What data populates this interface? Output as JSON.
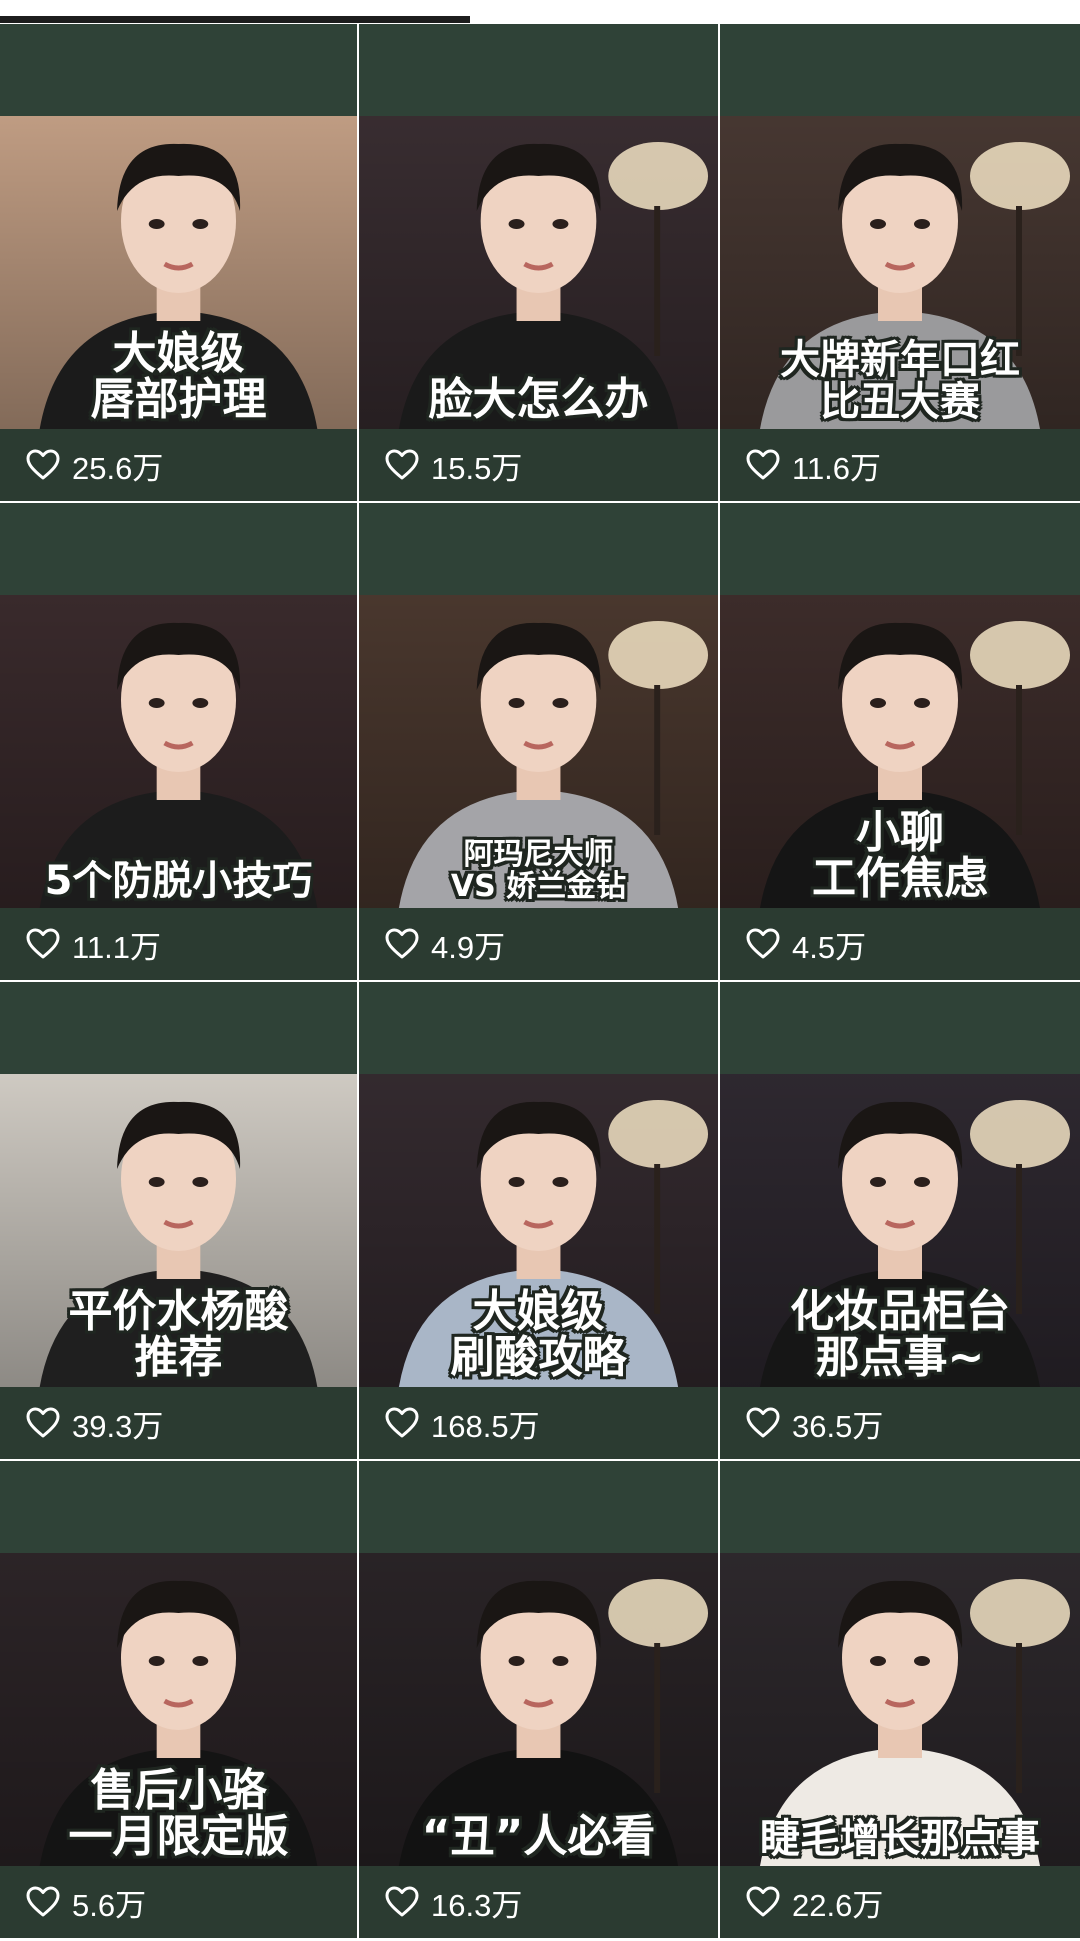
{
  "progress": {
    "fraction": 0.5
  },
  "videos": [
    {
      "caption_l1": "大娘级",
      "caption_l2": "唇部护理",
      "likes": "25.6万",
      "bg": "#c9a489",
      "shirt": "#1b1b1b"
    },
    {
      "caption_l1": "",
      "caption_l2": "脸大怎么办",
      "likes": "15.5万",
      "bg": "#3b2f33",
      "shirt": "#1a1a1a"
    },
    {
      "caption_l1": "大牌新年口红",
      "caption_l2": "比丑大赛",
      "likes": "11.6万",
      "bg": "#4a3a34",
      "shirt": "#9a9a9c"
    },
    {
      "caption_l1": "",
      "caption_l2": "5个防脱小技巧",
      "likes": "11.1万",
      "bg": "#3c2c2e",
      "shirt": "#1c1c1c"
    },
    {
      "caption_l1": "阿玛尼大师",
      "caption_l2": "VS 娇兰金钻",
      "likes": "4.9万",
      "bg": "#4d3a30",
      "shirt": "#a4a4a8"
    },
    {
      "caption_l1": "小聊",
      "caption_l2": "工作焦虑",
      "likes": "4.5万",
      "bg": "#3f2e2c",
      "shirt": "#151515"
    },
    {
      "caption_l1": "平价水杨酸",
      "caption_l2": "推荐",
      "likes": "39.3万",
      "bg": "#d9d4cc",
      "shirt": "#1f1f1f"
    },
    {
      "caption_l1": "大娘级",
      "caption_l2": "刷酸攻略",
      "likes": "168.5万",
      "bg": "#362c31",
      "shirt": "#a9b6c7"
    },
    {
      "caption_l1": "化妆品柜台",
      "caption_l2": "那点事~",
      "likes": "36.5万",
      "bg": "#302a32",
      "shirt": "#161616"
    },
    {
      "caption_l1": "售后小骆",
      "caption_l2": "一月限定版",
      "likes": "5.6万",
      "bg": "#2e2629",
      "shirt": "#141414"
    },
    {
      "caption_l1": "",
      "caption_l2": "“丑”人必看",
      "likes": "16.3万",
      "bg": "#2b2528",
      "shirt": "#121212"
    },
    {
      "caption_l1": "",
      "caption_l2": "睫毛增长那点事",
      "likes": "22.6万",
      "bg": "#2f2a2e",
      "shirt": "#eeeae4"
    }
  ],
  "icons": {
    "like": "heart-outline-icon"
  }
}
